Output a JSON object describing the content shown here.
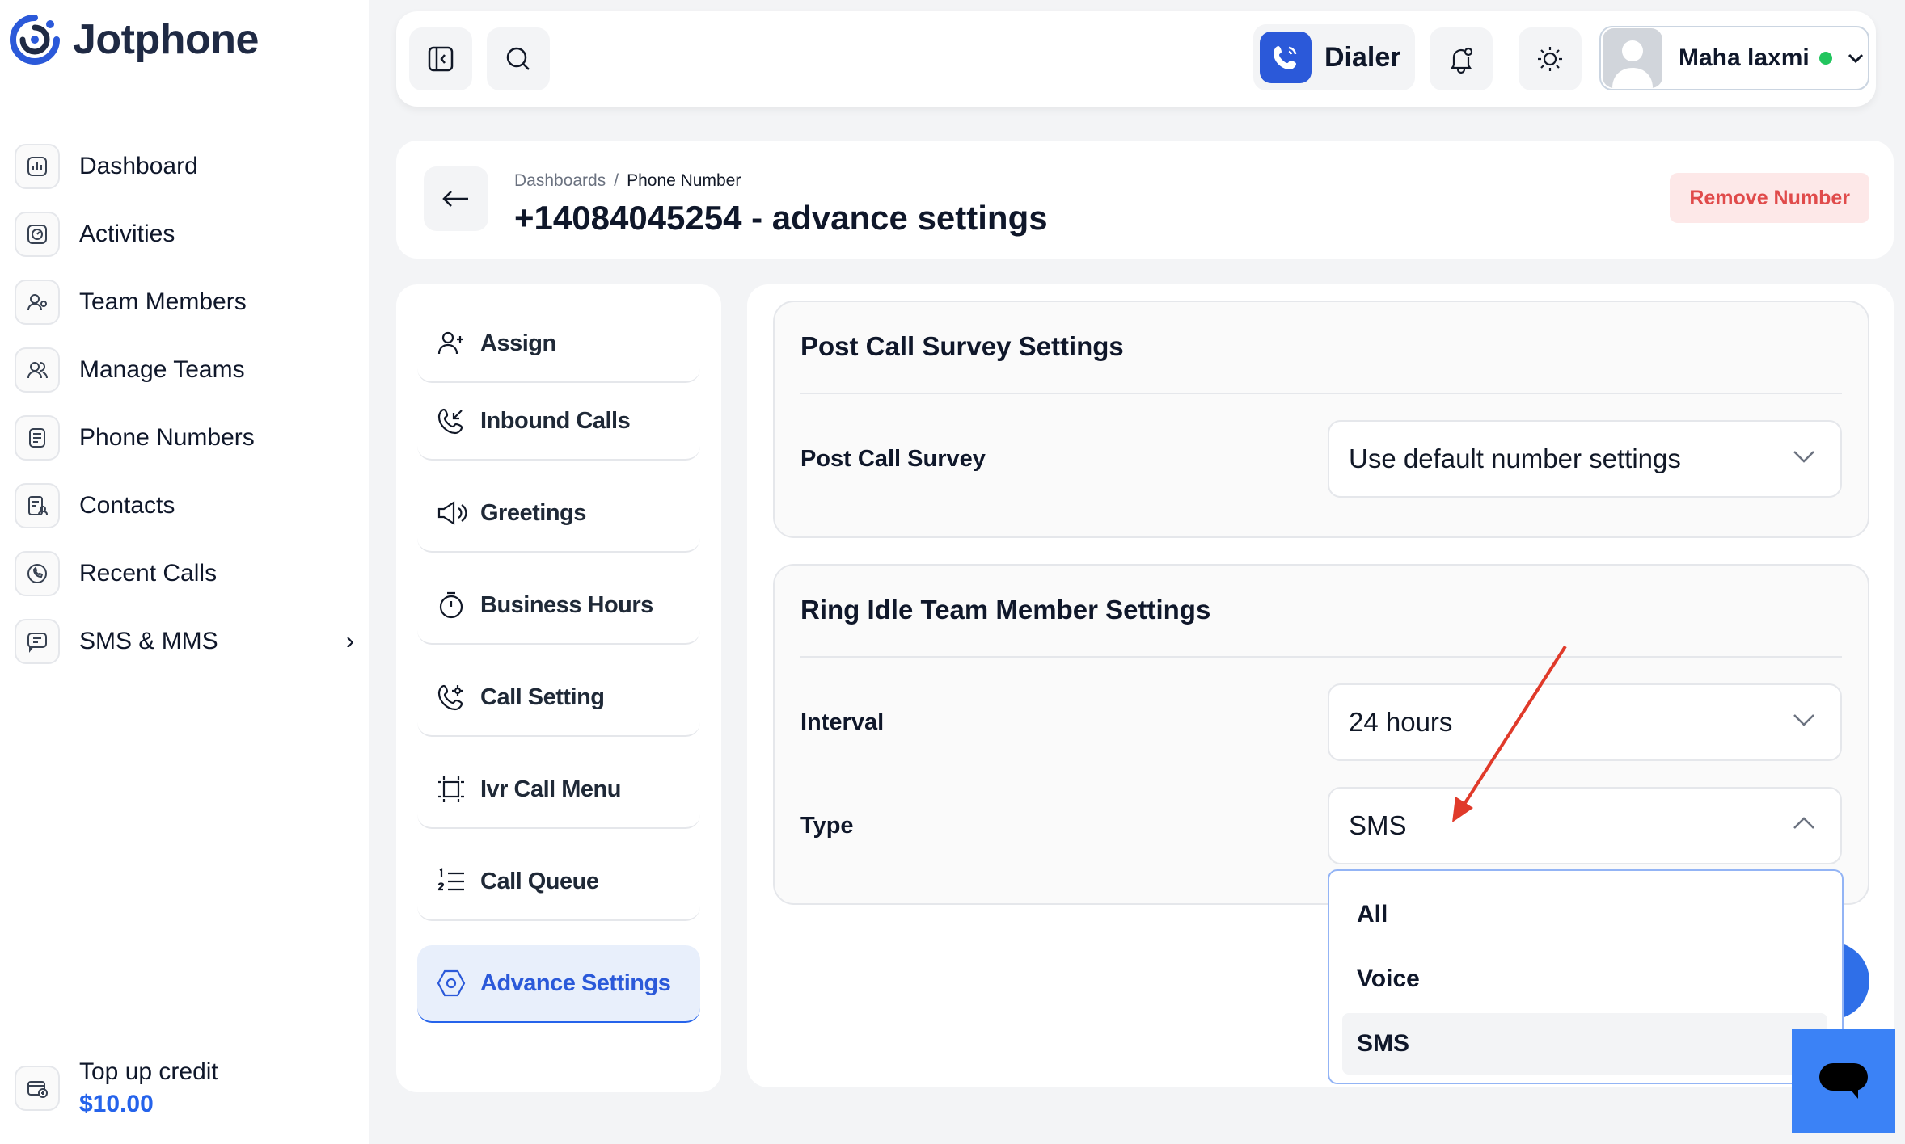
{
  "sidebar": {
    "brand": "Jotphone",
    "items": [
      {
        "label": "Dashboard",
        "icon": "chart-icon"
      },
      {
        "label": "Activities",
        "icon": "activity-icon"
      },
      {
        "label": "Team Members",
        "icon": "team-members-icon"
      },
      {
        "label": "Manage Teams",
        "icon": "manage-teams-icon"
      },
      {
        "label": "Phone Numbers",
        "icon": "phone-numbers-icon"
      },
      {
        "label": "Contacts",
        "icon": "contacts-icon"
      },
      {
        "label": "Recent Calls",
        "icon": "recent-calls-icon"
      },
      {
        "label": "SMS & MMS",
        "icon": "sms-icon"
      }
    ],
    "topup": {
      "label": "Top up credit",
      "value": "$10.00"
    }
  },
  "topbar": {
    "dialer_label": "Dialer",
    "user_name": "Maha laxmi",
    "user_status_color": "#22c55e"
  },
  "header": {
    "breadcrumb": [
      "Dashboards",
      "Phone Number"
    ],
    "separator": "/",
    "title": "+14084045254 - advance settings",
    "remove_label": "Remove Number"
  },
  "menu": {
    "items": [
      {
        "label": "Assign",
        "icon": "user-plus-icon"
      },
      {
        "label": "Inbound Calls",
        "icon": "inbound-call-icon"
      },
      {
        "label": "Greetings",
        "icon": "megaphone-icon"
      },
      {
        "label": "Business Hours",
        "icon": "stopwatch-icon"
      },
      {
        "label": "Call Setting",
        "icon": "phone-settings-icon"
      },
      {
        "label": "Ivr Call Menu",
        "icon": "ivr-menu-icon"
      },
      {
        "label": "Call Queue",
        "icon": "numbered-list-icon"
      },
      {
        "label": "Advance Settings",
        "icon": "hexagon-settings-icon",
        "active": true
      }
    ]
  },
  "post_call": {
    "title": "Post Call Survey Settings",
    "survey_label": "Post Call Survey",
    "survey_value": "Use default number settings"
  },
  "ring_idle": {
    "title": "Ring Idle Team Member Settings",
    "interval_label": "Interval",
    "interval_value": "24 hours",
    "type_label": "Type",
    "type_value": "SMS",
    "type_options": [
      "All",
      "Voice",
      "SMS"
    ],
    "type_selected": "SMS"
  },
  "colors": {
    "accent": "#2b59d9",
    "danger": "#e04b4b",
    "annotation_arrow": "#e03a2a"
  }
}
